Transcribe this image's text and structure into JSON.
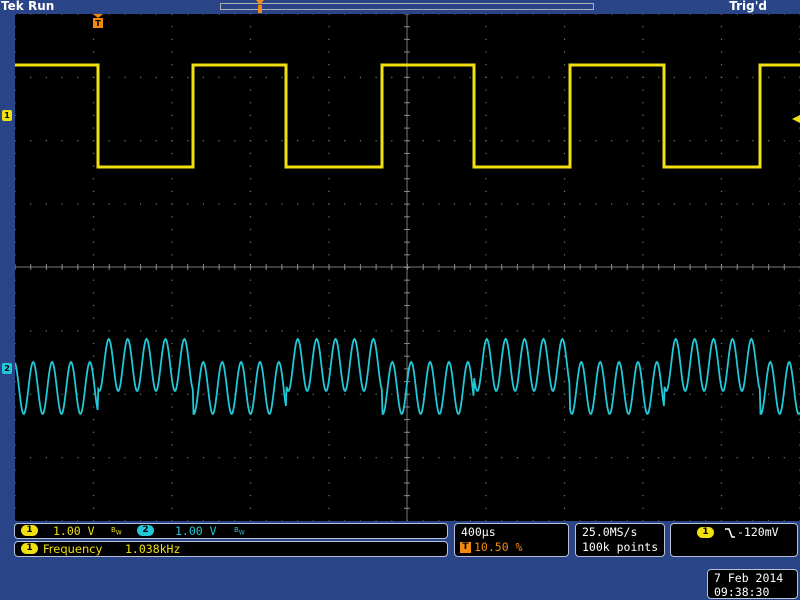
{
  "header": {
    "brand": "Tek",
    "run_state": "Run",
    "trigger_status": "Trig'd"
  },
  "channels": {
    "ch1": {
      "label": "1",
      "scale": "1.00 V",
      "color": "#f0e010"
    },
    "ch2": {
      "label": "2",
      "scale": "1.00 V",
      "color": "#22c8d8"
    },
    "bw_icon": "bandwidth-limit-icon"
  },
  "measurement": {
    "channel": "1",
    "name": "Frequency",
    "value": "1.038kHz"
  },
  "timebase": {
    "scale": "400µs",
    "trigger_marker": "T",
    "position": "10.50 %"
  },
  "acquisition": {
    "sample_rate": "25.0MS/s",
    "record_length": "100k points"
  },
  "trigger": {
    "channel": "1",
    "slope": "falling-edge-icon",
    "level": "-120mV"
  },
  "datetime": {
    "date": "7 Feb  2014",
    "time": "09:38:30"
  },
  "waveforms": {
    "ch1_square": {
      "freq_khz": 1.038,
      "high_v": 2.05,
      "low_v": -0.0,
      "trigger_edge": "falling"
    },
    "ch2_am_sine": {
      "carrier_cycles_per_half_period": 5
    }
  }
}
